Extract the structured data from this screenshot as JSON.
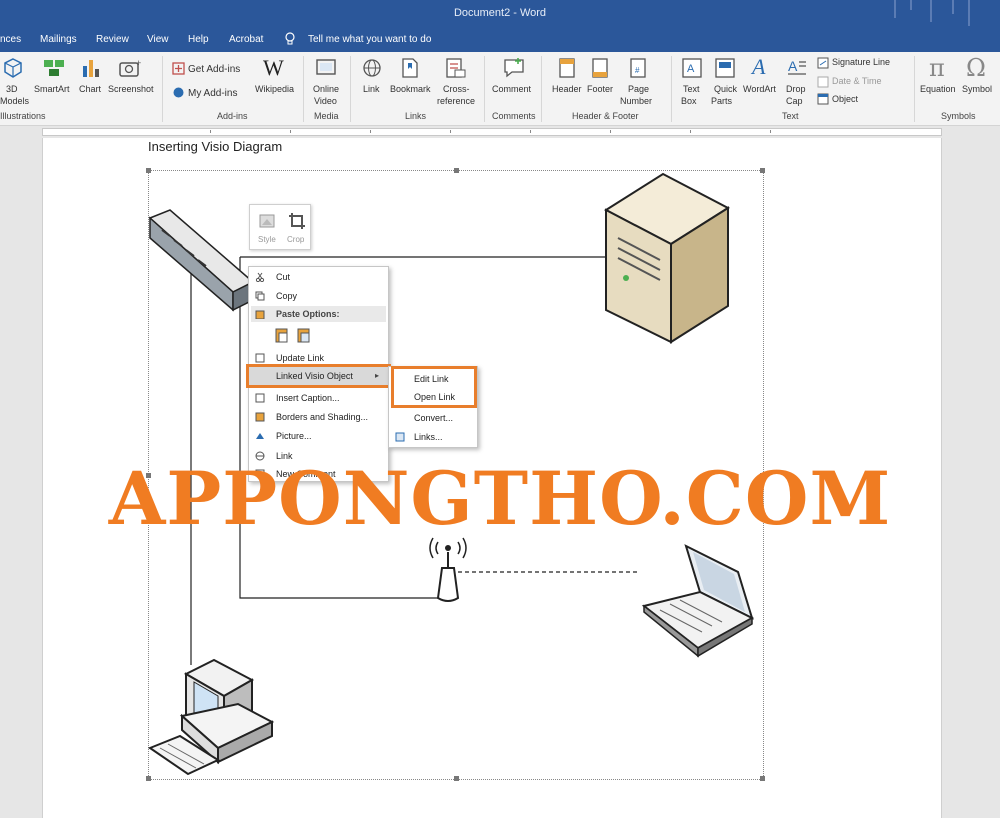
{
  "window": {
    "title": "Document2 - Word"
  },
  "tabs": [
    {
      "label": "nces"
    },
    {
      "label": "Mailings"
    },
    {
      "label": "Review"
    },
    {
      "label": "View"
    },
    {
      "label": "Help"
    },
    {
      "label": "Acrobat"
    }
  ],
  "tell_me": {
    "placeholder": "Tell me what you want to do",
    "icon": "lightbulb-icon"
  },
  "ribbon": {
    "illustrations": {
      "models_label": "3D",
      "models_sub": "Models",
      "smartart": "SmartArt",
      "chart": "Chart",
      "screenshot": "Screenshot",
      "group": "Illustrations"
    },
    "addins": {
      "get_addins": "Get Add-ins",
      "my_addins": "My Add-ins",
      "wikipedia": "Wikipedia",
      "group": "Add-ins"
    },
    "media": {
      "online_video_1": "Online",
      "online_video_2": "Video",
      "group": "Media"
    },
    "links": {
      "link": "Link",
      "bookmark": "Bookmark",
      "cross_ref_1": "Cross-",
      "cross_ref_2": "reference",
      "group": "Links"
    },
    "comments": {
      "comment": "Comment",
      "group": "Comments"
    },
    "header_footer": {
      "header": "Header",
      "footer": "Footer",
      "page_number_1": "Page",
      "page_number_2": "Number",
      "group": "Header & Footer"
    },
    "text": {
      "text_box_1": "Text",
      "text_box_2": "Box",
      "quick_parts_1": "Quick",
      "quick_parts_2": "Parts",
      "wordart": "WordArt",
      "drop_cap_1": "Drop",
      "drop_cap_2": "Cap",
      "signature_line": "Signature Line",
      "date_time": "Date & Time",
      "object": "Object",
      "group": "Text"
    },
    "symbols": {
      "equation": "Equation",
      "symbol": "Symbol",
      "group": "Symbols"
    }
  },
  "document": {
    "heading": "Inserting Visio Diagram"
  },
  "mini_toolbar": {
    "style": "Style",
    "crop": "Crop"
  },
  "context_menu": {
    "cut": "Cut",
    "copy": "Copy",
    "paste_options": "Paste Options:",
    "update_link": "Update Link",
    "linked_visio": "Linked Visio Object",
    "insert_caption": "Insert Caption...",
    "borders": "Borders and Shading...",
    "picture": "Picture...",
    "link": "Link",
    "new_comment": "New Comment"
  },
  "submenu": {
    "edit_link": "Edit Link",
    "open_link": "Open Link",
    "convert": "Convert...",
    "links": "Links..."
  },
  "watermark": {
    "text": "APPONGTHO.COM"
  },
  "colors": {
    "titlebar": "#2b579a",
    "highlight": "#e87e2c",
    "watermark": "#f07c22"
  }
}
